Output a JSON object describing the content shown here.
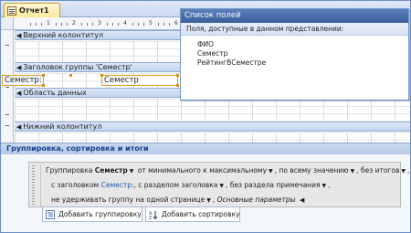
{
  "tab": {
    "label": "Отчет1"
  },
  "ruler": {
    "numbers": [
      "1",
      "2",
      "3",
      "4",
      "5",
      "6"
    ]
  },
  "sections": {
    "page_header": "Верхний колонтитул",
    "group_header": "Заголовок группы 'Семестр'",
    "detail": "Область данных",
    "page_footer": "Нижний колонтитул"
  },
  "controls": {
    "label_text": "Семестр:",
    "field_text": "Семестр"
  },
  "field_list": {
    "title": "Список полей",
    "subtitle": "Поля, доступные в данном представлении:",
    "fields": [
      "ФИО",
      "Семестр",
      "РейтингВСеместре"
    ]
  },
  "grouping": {
    "header": "Группировка, сортировка и итоги",
    "line1": {
      "prefix": "Группировка",
      "field": "Семестр",
      "sort": "от минимального к максимальному",
      "by": "по всему значению",
      "totals": "без итогов"
    },
    "line2": {
      "header_prefix": "с заголовком",
      "header_field": "Семестр:",
      "section": "с разделом заголовка",
      "footer": "без раздела примечания"
    },
    "line3": {
      "keep": "не удерживать группу на одной странице",
      "basic": "Основные параметры"
    },
    "add_group": "Добавить группировку",
    "add_sort": "Добавить сортировку"
  }
}
